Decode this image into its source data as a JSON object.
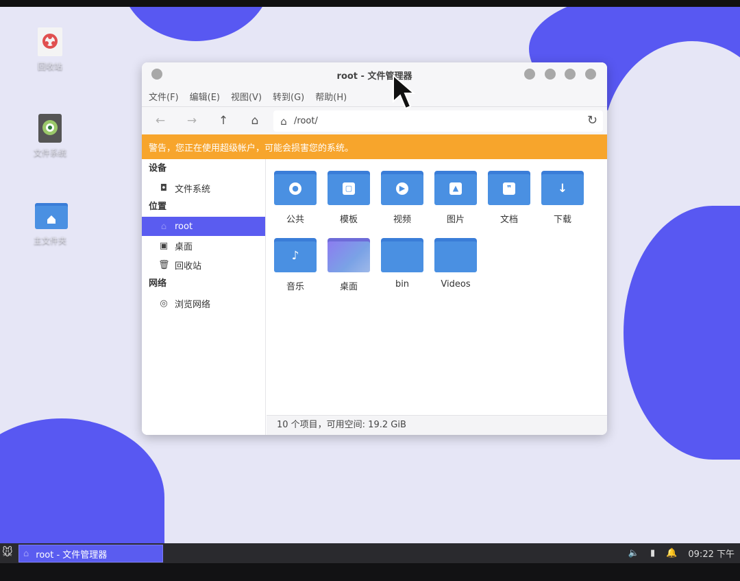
{
  "desktop": {
    "icons": [
      {
        "label": "回收站",
        "icon": "trash-icon"
      },
      {
        "label": "文件系统",
        "icon": "filesystem-icon"
      },
      {
        "label": "主文件夹",
        "icon": "home-folder-icon"
      }
    ]
  },
  "window": {
    "title": "root - 文件管理器",
    "menu": [
      "文件(F)",
      "编辑(E)",
      "视图(V)",
      "转到(G)",
      "帮助(H)"
    ],
    "path": "/root/",
    "warning": "警告，您正在使用超级帐户，可能会损害您的系统。",
    "sidebar": {
      "devices_header": "设备",
      "devices": [
        {
          "label": "文件系统",
          "icon": "drive-icon"
        }
      ],
      "places_header": "位置",
      "places": [
        {
          "label": "root",
          "icon": "home-icon",
          "active": true
        },
        {
          "label": "桌面",
          "icon": "desktop-icon"
        },
        {
          "label": "回收站",
          "icon": "trash-icon"
        }
      ],
      "network_header": "网络",
      "network": [
        {
          "label": "浏览网络",
          "icon": "network-icon"
        }
      ]
    },
    "items": [
      {
        "label": "公共",
        "icon": "person-icon"
      },
      {
        "label": "模板",
        "icon": "template-icon"
      },
      {
        "label": "视频",
        "icon": "play-icon"
      },
      {
        "label": "图片",
        "icon": "image-icon"
      },
      {
        "label": "文档",
        "icon": "document-icon"
      },
      {
        "label": "下载",
        "icon": "download-icon"
      },
      {
        "label": "音乐",
        "icon": "music-icon"
      },
      {
        "label": "桌面",
        "icon": "desktop-preview-icon"
      },
      {
        "label": "bin",
        "icon": "folder-icon"
      },
      {
        "label": "Videos",
        "icon": "folder-icon"
      }
    ],
    "status": "10 个项目，可用空间: 19.2 GiB"
  },
  "taskbar": {
    "task_label": "root - 文件管理器",
    "clock": "09:22 下午"
  },
  "colors": {
    "accent": "#5a5cf0",
    "warning": "#f7a52c",
    "folder": "#4a90e2"
  }
}
